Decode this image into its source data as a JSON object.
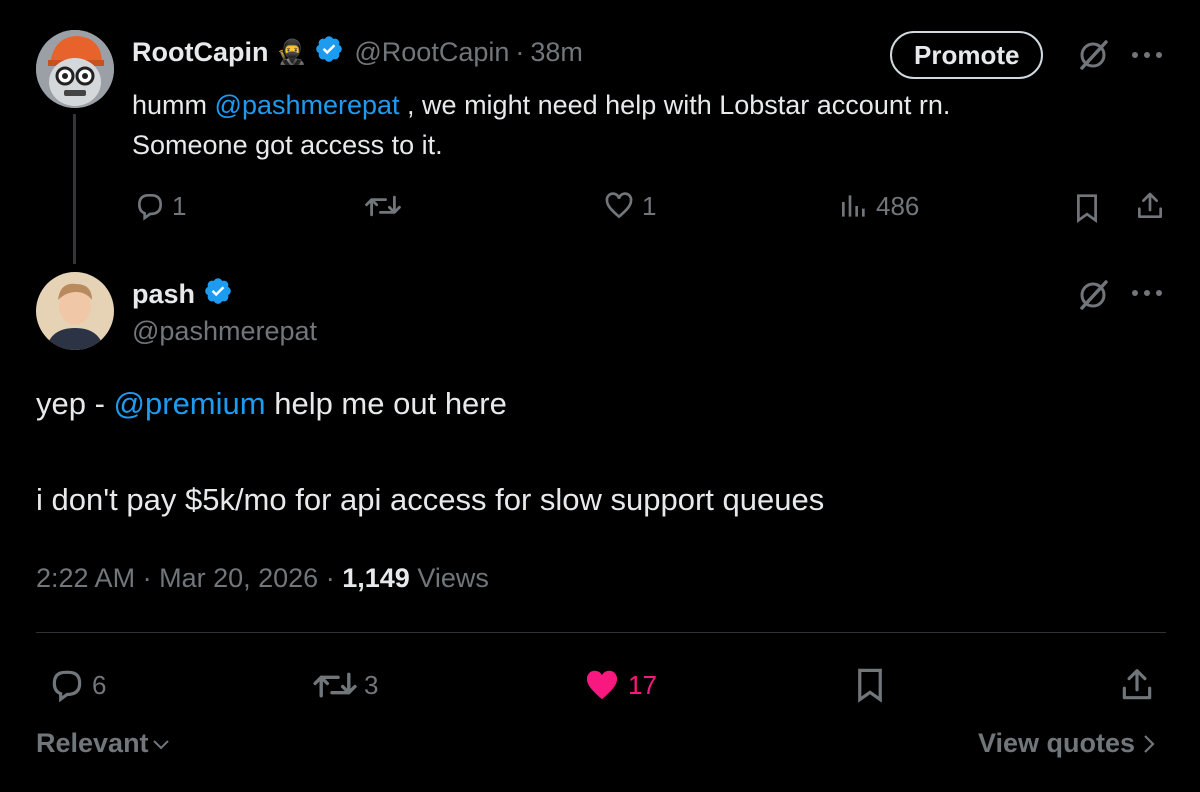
{
  "parent": {
    "display_name": "RootCapin",
    "emoji": "🥷",
    "handle": "@RootCapin",
    "separator": "·",
    "time": "38m",
    "promote_label": "Promote",
    "text_prefix": "humm ",
    "mention": "@pashmerepat",
    "text_rest": " , we might need help with Lobstar account rn.",
    "text_line2": "Someone got access to it.",
    "replies": "1",
    "reposts": "",
    "likes": "1",
    "views": "486"
  },
  "main": {
    "display_name": "pash",
    "handle": "@pashmerepat",
    "line1_prefix": "yep - ",
    "line1_mention": "@premium",
    "line1_rest": " help me out here",
    "line2": "i don't pay $5k/mo for api access for slow support queues",
    "time": "2:22 AM",
    "sep1": "·",
    "date": "Mar 20, 2026",
    "sep2": "·",
    "views_count": "1,149",
    "views_label": "Views",
    "replies": "6",
    "reposts": "3",
    "likes": "17"
  },
  "footer": {
    "sort_label": "Relevant",
    "view_quotes": "View quotes"
  },
  "colors": {
    "background": "#000000",
    "text": "#e7e9ea",
    "muted": "#71767b",
    "link": "#1d9bf0",
    "like_active": "#f91880",
    "verified": "#1d9bf0"
  }
}
